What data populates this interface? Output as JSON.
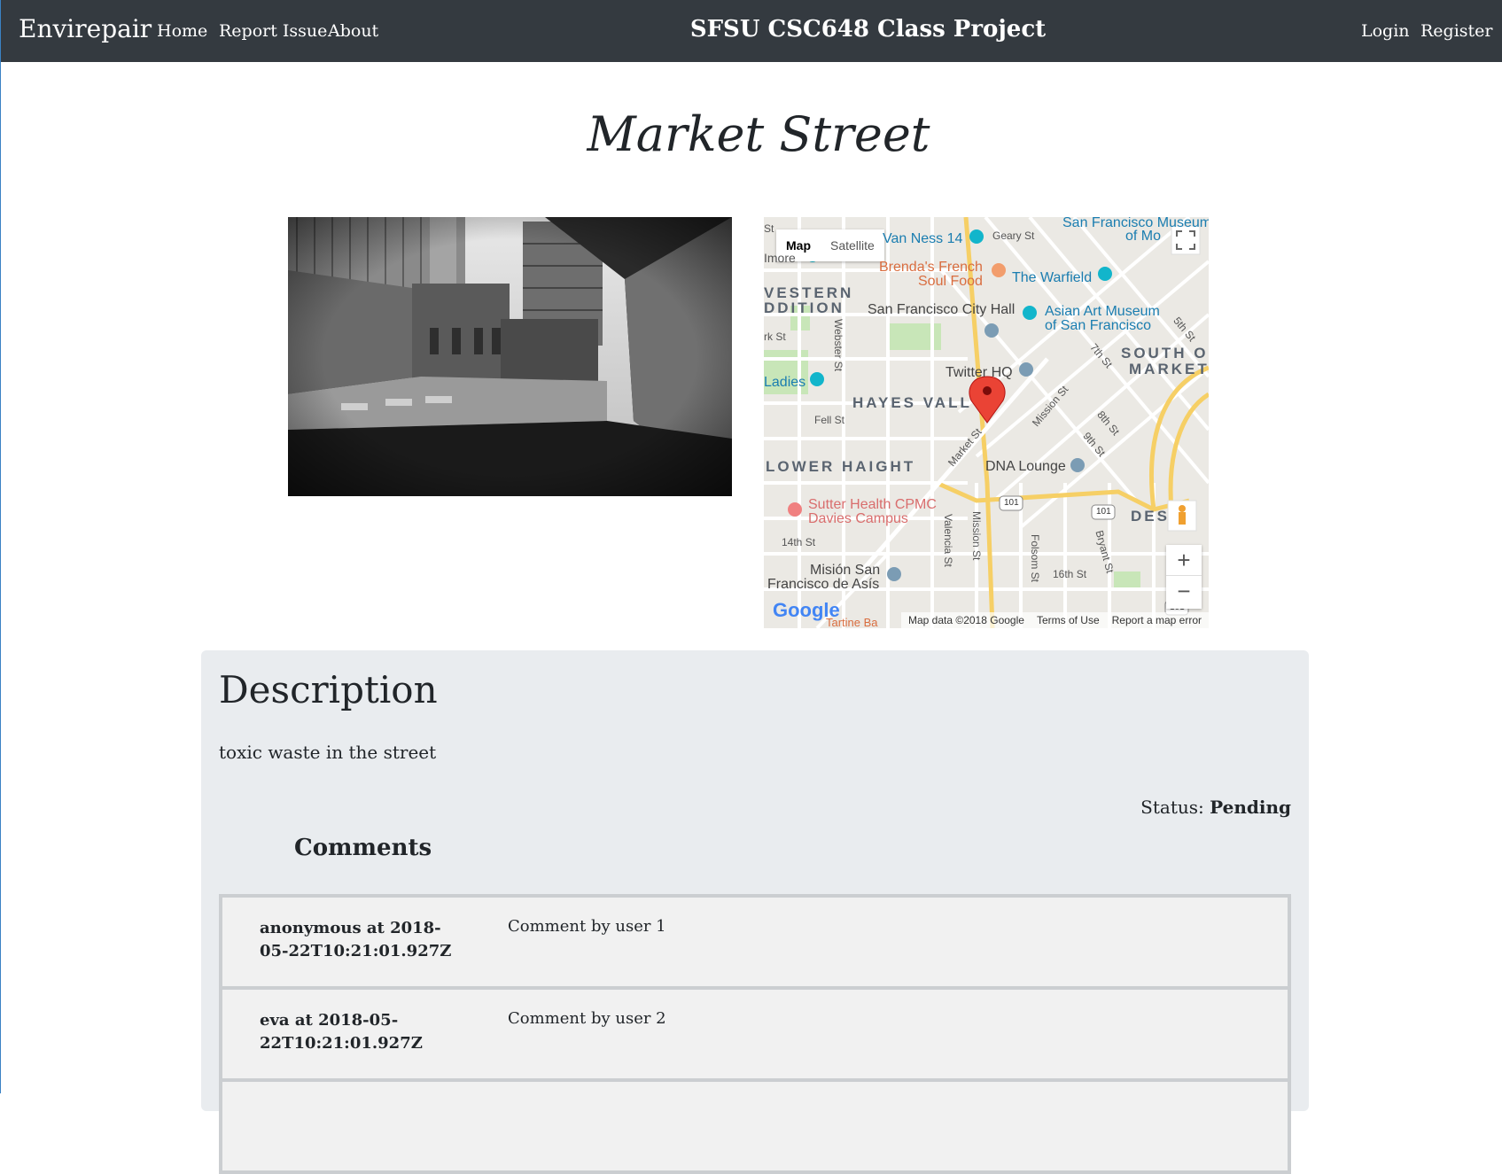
{
  "navbar": {
    "brand": "Envirepair",
    "links": [
      "Home",
      "Report Issue",
      "About"
    ],
    "title": "SFSU CSC648 Class Project",
    "right_links": [
      "Login",
      "Register"
    ]
  },
  "page": {
    "title": "Market Street"
  },
  "map": {
    "type_map": "Map",
    "type_satellite": "Satellite",
    "zoom_in": "+",
    "zoom_out": "−",
    "footer_data": "Map data ©2018 Google",
    "footer_terms": "Terms of Use",
    "footer_report": "Report a map error",
    "logo": "Google",
    "labels": {
      "van_ness": "Van Ness 14",
      "geary": "Geary St",
      "sfmoma": "San Francisco Museum",
      "sfmoma2": "of Mo",
      "brendas": "Brenda's French",
      "brendas2": "Soul Food",
      "warfield": "The Warfield",
      "western": "VESTERN",
      "addition": "DDITION",
      "city_hall": "San Francisco City Hall",
      "asian_art": "Asian Art Museum",
      "asian_art2": "of San Francisco",
      "south": "SOUTH O",
      "market_area": "MARKET",
      "twitter": "Twitter HQ",
      "ladies": "Ladies",
      "hayes": "HAYES VALL",
      "fell": "Fell St",
      "lower_haight": "LOWER HAIGHT",
      "dna": "DNA Lounge",
      "sutter": "Sutter Health CPMC",
      "sutter2": "Davies Campus",
      "fourteenth": "14th St",
      "mision": "Misión San",
      "mision2": "Francisco de Asís",
      "sixteenth": "16th St",
      "des": "DES",
      "webster": "Webster St",
      "valencia": "Valencia St",
      "mission_st": "Mission St",
      "folsom": "Folsom St",
      "bryant": "Bryant St",
      "market_st": "Market St",
      "mission_diag": "Mission St",
      "fifth": "5th St",
      "seventh": "7th St",
      "eighth": "8th St",
      "ninth": "9th St",
      "hwy": "101",
      "tartine": "Tartine Ba",
      "imore": "Imore",
      "ark": "rk St",
      "st": "St"
    }
  },
  "description": {
    "heading": "Description",
    "text": "toxic waste in the street",
    "status_label": "Status:",
    "status_value": "Pending",
    "comments_heading": "Comments",
    "comments": [
      {
        "meta": "anonymous at 2018-05-22T10:21:01.927Z",
        "body": "Comment by user 1"
      },
      {
        "meta": "eva at 2018-05-22T10:21:01.927Z",
        "body": "Comment by user 2"
      }
    ]
  }
}
